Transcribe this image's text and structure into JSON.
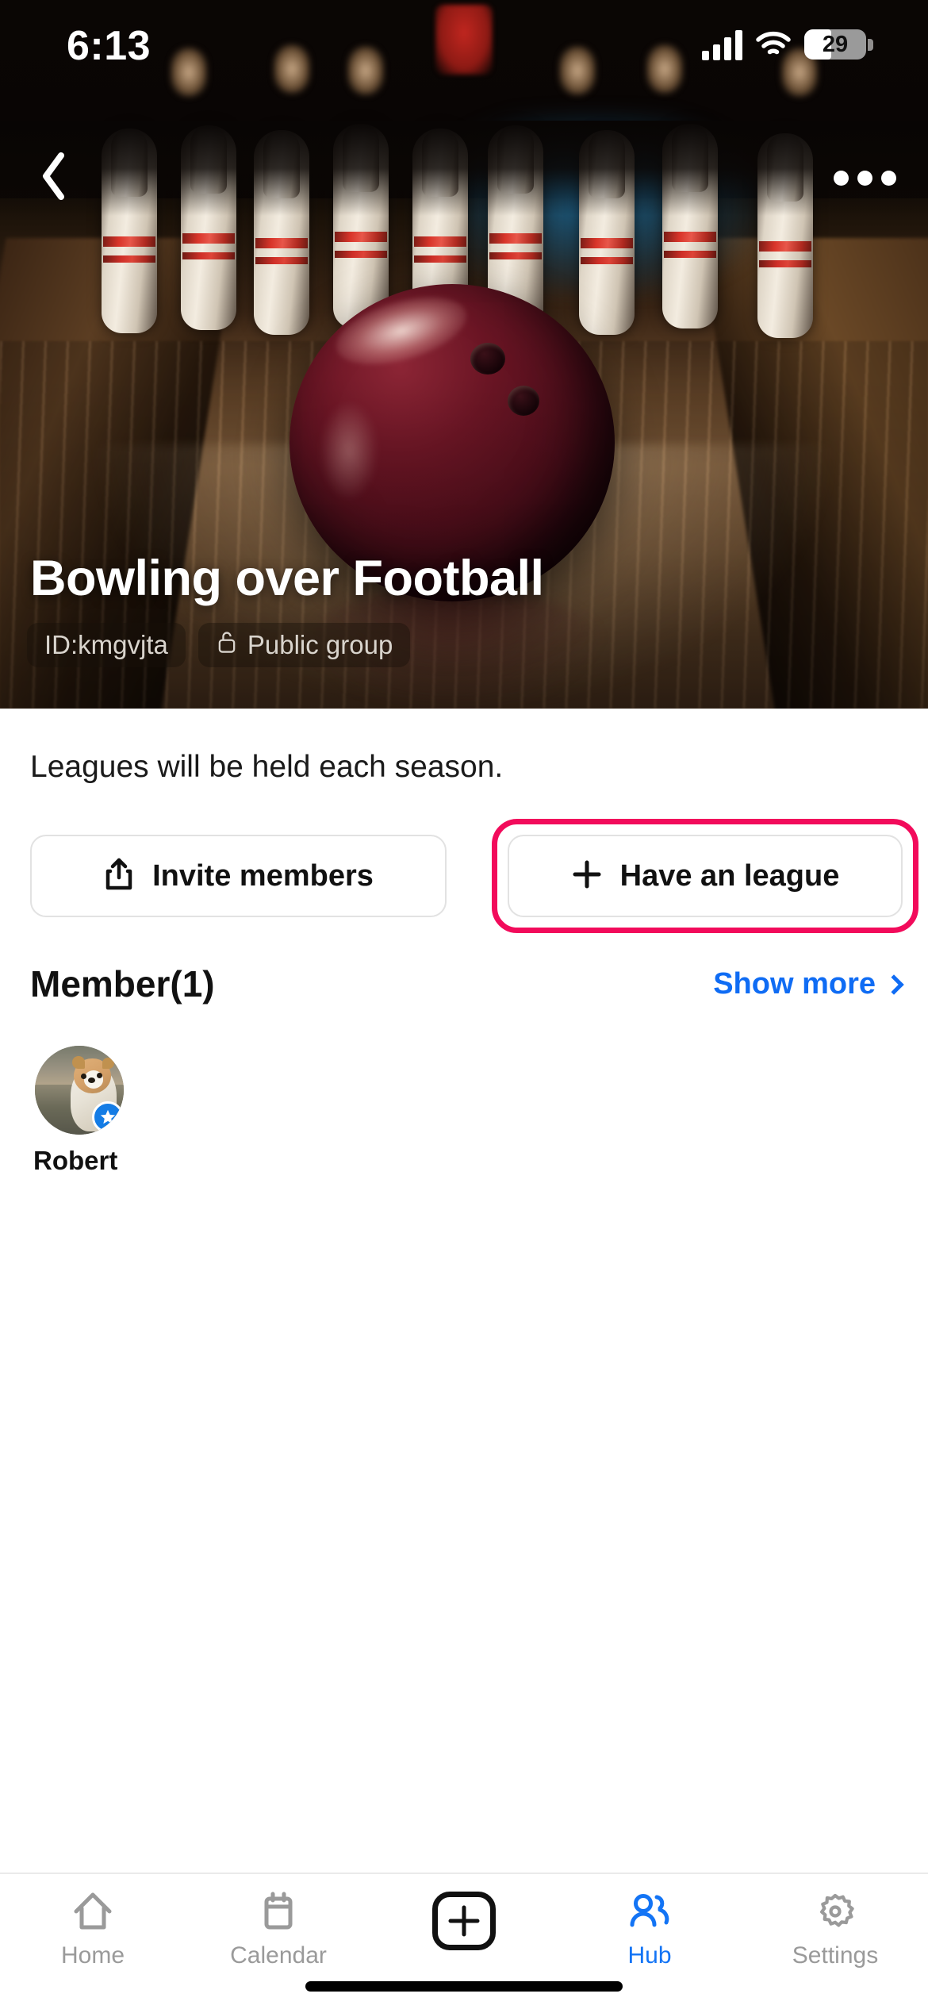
{
  "status_bar": {
    "time": "6:13",
    "battery_percent": "29",
    "wifi_icon": "wifi-icon",
    "signal_icon": "cellular-signal-icon",
    "battery_icon": "battery-icon"
  },
  "nav": {
    "back_icon": "back-chevron-icon",
    "more_icon": "more-options-icon"
  },
  "hero": {
    "title": "Bowling over Football",
    "badges": [
      {
        "label": "ID:kmgvjta",
        "icon": null
      },
      {
        "label": "Public group",
        "icon": "unlock-icon"
      }
    ],
    "image_alt": "bowling-lane-photo"
  },
  "main": {
    "description": "Leagues will be held each season.",
    "actions": [
      {
        "label": "Invite members",
        "icon": "share-icon",
        "highlighted": false
      },
      {
        "label": "Have an league",
        "icon": "plus-icon",
        "highlighted": true
      }
    ],
    "highlight_color": "#F20B5B",
    "members_section": {
      "title": "Member(1)",
      "show_more_label": "Show more",
      "show_more_icon": "chevron-right-icon",
      "link_color": "#0F6CF4",
      "members": [
        {
          "name": "Robert",
          "badge": "star-badge",
          "avatar_alt": "pomeranian-dog-avatar"
        }
      ]
    }
  },
  "tab_bar": {
    "active_color": "#1374F5",
    "inactive_color": "#9A9A9A",
    "tabs": [
      {
        "label": "Home",
        "icon": "home-icon",
        "active": false
      },
      {
        "label": "Calendar",
        "icon": "calendar-icon",
        "active": false
      },
      {
        "label": "",
        "icon": "create-plus-icon",
        "active": false
      },
      {
        "label": "Hub",
        "icon": "hub-people-icon",
        "active": true
      },
      {
        "label": "Settings",
        "icon": "settings-gear-icon",
        "active": false
      }
    ]
  }
}
